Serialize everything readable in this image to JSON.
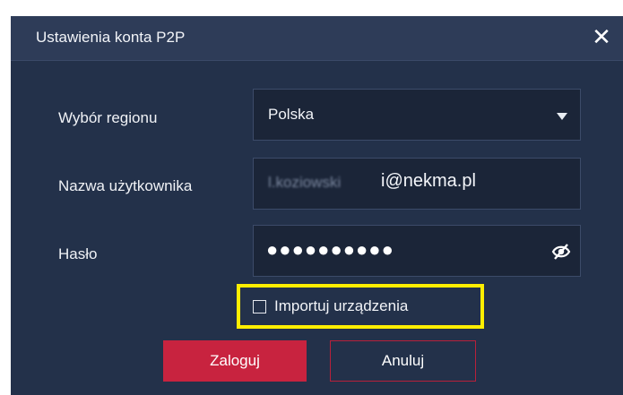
{
  "dialog": {
    "title": "Ustawienia konta P2P",
    "close_glyph": "✕"
  },
  "region": {
    "label": "Wybór regionu",
    "value": "Polska"
  },
  "username": {
    "label": "Nazwa użytkownika",
    "value_blurred": "l.koziowski",
    "value_visible": "i@nekma.pl"
  },
  "password": {
    "label": "Hasło",
    "masked_value": "●●●●●●●●●●",
    "toggle_icon": "eye-slash-icon"
  },
  "import_devices": {
    "label": "Importuj urządzenia",
    "checked": false,
    "highlight_color": "#ffee00"
  },
  "buttons": {
    "login_label": "Zaloguj",
    "cancel_label": "Anuluj"
  },
  "colors": {
    "dialog_bg": "#23314a",
    "accent_red": "#c8233f"
  }
}
